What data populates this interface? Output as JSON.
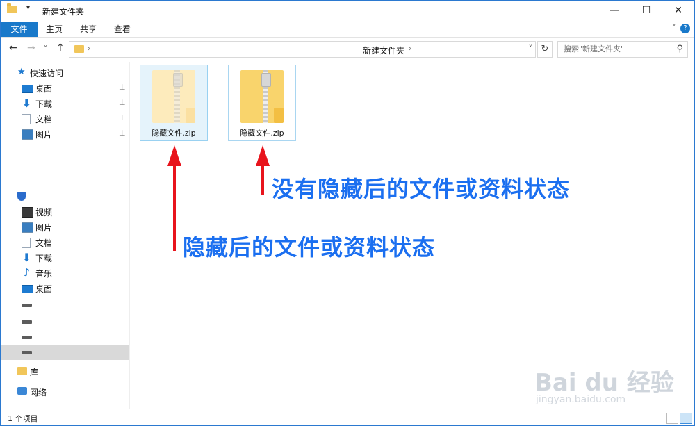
{
  "window": {
    "title": "新建文件夹",
    "quick_access_dropdown": "▾",
    "minimize": "—",
    "maximize": "☐",
    "close": "✕"
  },
  "ribbon": {
    "tabs": [
      "文件",
      "主页",
      "共享",
      "查看"
    ],
    "collapse": "˅",
    "help": "?"
  },
  "address": {
    "path_label": "新建文件夹",
    "chevron": "›",
    "dropdown": "˅",
    "refresh": "↻"
  },
  "search": {
    "placeholder": "搜索\"新建文件夹\"",
    "icon": "⚲"
  },
  "nav": {
    "back": "←",
    "forward": "→",
    "recent": "˅",
    "up": "↑"
  },
  "sidebar": {
    "quick_access": "快速访问",
    "pinned": [
      {
        "label": "桌面",
        "icon": "desktop-icon"
      },
      {
        "label": "下载",
        "icon": "download-icon"
      },
      {
        "label": "文档",
        "icon": "document-icon"
      },
      {
        "label": "图片",
        "icon": "picture-icon"
      }
    ],
    "pin_glyph": "⊥",
    "this_pc": [
      {
        "label": "视频",
        "icon": "video-icon"
      },
      {
        "label": "图片",
        "icon": "picture-icon"
      },
      {
        "label": "文档",
        "icon": "document-icon"
      },
      {
        "label": "下载",
        "icon": "download-icon"
      },
      {
        "label": "音乐",
        "icon": "music-icon"
      },
      {
        "label": "桌面",
        "icon": "desktop-icon"
      }
    ],
    "library": "库",
    "network": "网络"
  },
  "files": [
    {
      "name": "隐藏文件.zip",
      "hidden": true
    },
    {
      "name": "隐藏文件.zip",
      "hidden": false
    }
  ],
  "annotations": {
    "top": "没有隐藏后的文件或资料状态",
    "bottom": "隐藏后的文件或资料状态",
    "arrow_color": "#e8141c",
    "text_color": "#1b6ff0"
  },
  "status": {
    "text": "1 个项目"
  },
  "watermark": {
    "brand": "Bai du 经验",
    "url": "jingyan.baidu.com"
  }
}
